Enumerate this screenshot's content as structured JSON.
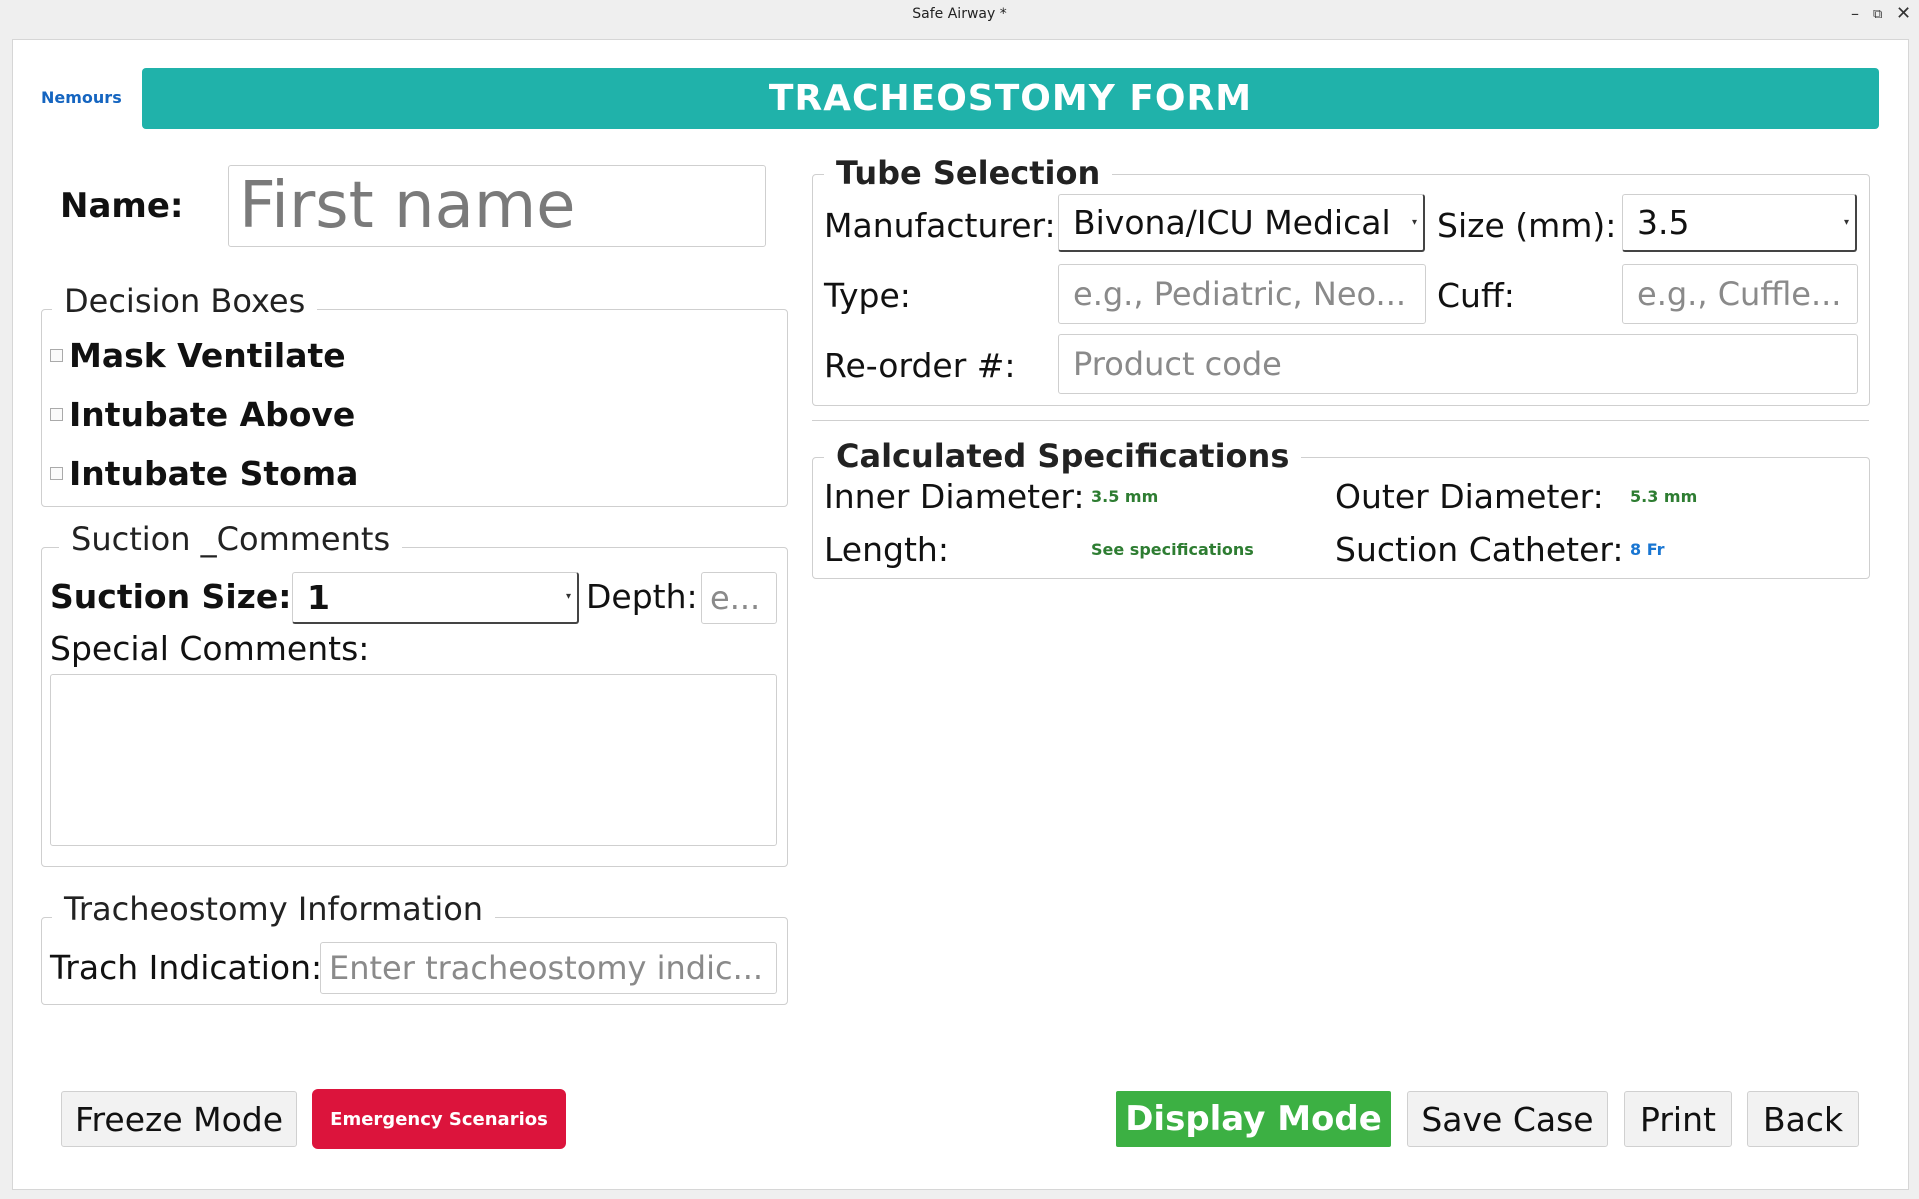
{
  "window": {
    "title": "Safe Airway *"
  },
  "header": {
    "logo": "Nemours",
    "title": "TRACHEOSTOMY FORM"
  },
  "name": {
    "label": "Name:",
    "placeholder": "First name",
    "value": ""
  },
  "decision_boxes": {
    "legend": "Decision Boxes",
    "items": [
      {
        "label": "Mask Ventilate",
        "checked": false
      },
      {
        "label": "Intubate Above",
        "checked": false
      },
      {
        "label": "Intubate Stoma",
        "checked": false
      }
    ]
  },
  "suction": {
    "legend": "Suction _Comments",
    "size_label": "Suction Size:",
    "size_value": "1",
    "depth_label": "Depth:",
    "depth_placeholder": "e...",
    "comments_label": "Special Comments:",
    "comments_value": ""
  },
  "trach_info": {
    "legend": "Tracheostomy Information",
    "indication_label": "Trach Indication:",
    "indication_placeholder": "Enter tracheostomy indic..."
  },
  "tube": {
    "legend": "Tube Selection",
    "manufacturer_label": "Manufacturer:",
    "manufacturer_value": "Bivona/ICU Medical",
    "size_label": "Size (mm):",
    "size_value": "3.5",
    "type_label": "Type:",
    "type_placeholder": "e.g., Pediatric, Neo...",
    "cuff_label": "Cuff:",
    "cuff_placeholder": "e.g., Cuffle...",
    "reorder_label": "Re-order #:",
    "reorder_placeholder": "Product code"
  },
  "specs": {
    "legend": "Calculated Specifications",
    "inner_label": "Inner Diameter:",
    "inner_value": "3.5 mm",
    "outer_label": "Outer Diameter:",
    "outer_value": "5.3 mm",
    "length_label": "Length:",
    "length_value": "See specifications",
    "catheter_label": "Suction Catheter:",
    "catheter_value": "8 Fr"
  },
  "buttons": {
    "freeze": "Freeze Mode",
    "emergency": "Emergency Scenarios",
    "display": "Display Mode",
    "save": "Save Case",
    "print": "Print",
    "back": "Back"
  },
  "colors": {
    "header": "#20b2aa",
    "emergency": "#dc143c",
    "display_mode": "#3cb043",
    "spec_green": "#2e7d32",
    "spec_blue": "#1976d2",
    "logo": "#1565c0"
  }
}
